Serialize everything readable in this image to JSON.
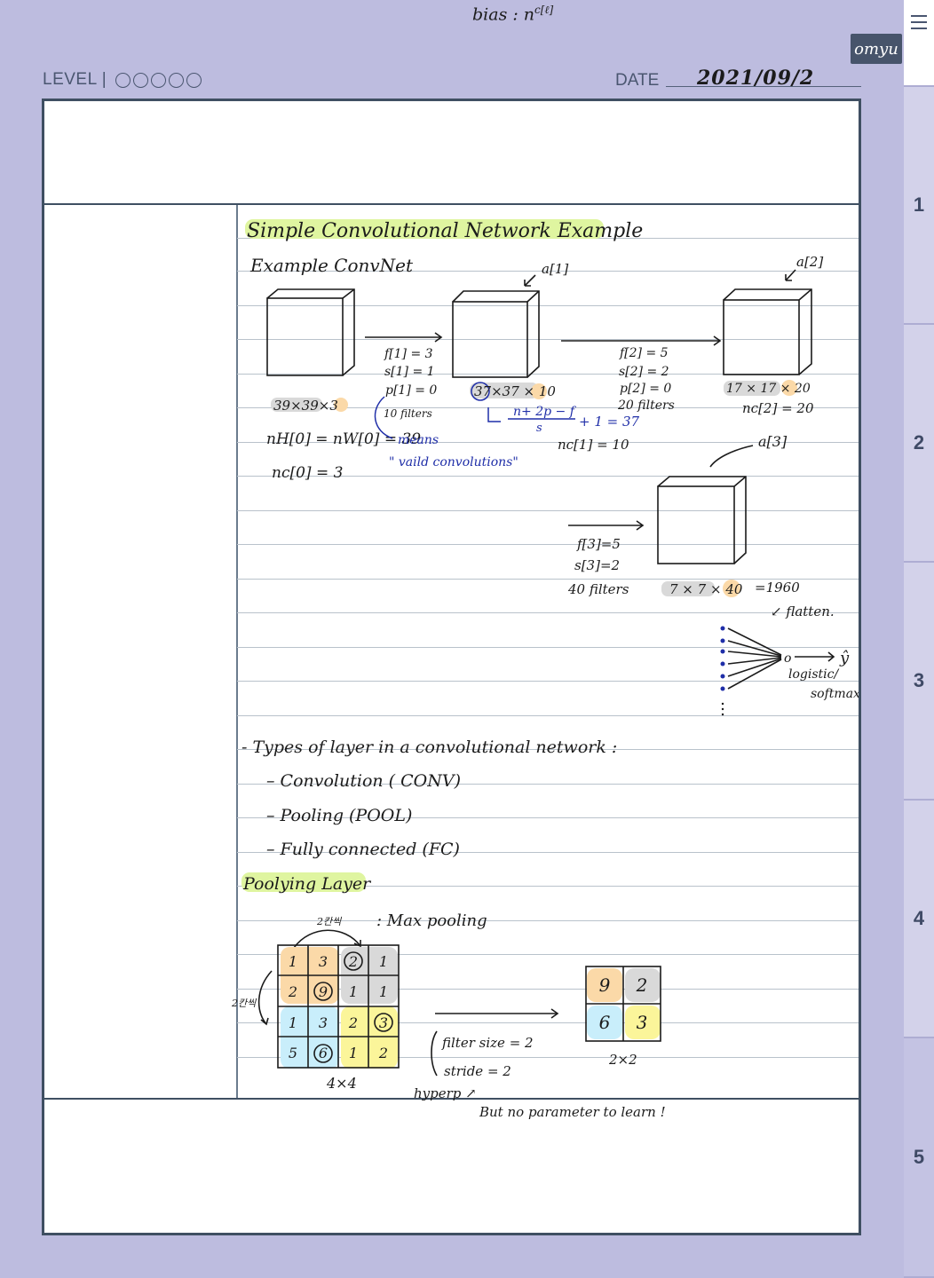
{
  "top": {
    "bias_note": "bias : n",
    "bias_sup": "c[ℓ]"
  },
  "header": {
    "level_label": "LEVEL |",
    "date_label": "DATE",
    "date_value": "2021/09/2"
  },
  "brand": {
    "name": "omyu"
  },
  "side_tabs": [
    "1",
    "2",
    "3",
    "4",
    "5"
  ],
  "colors": {
    "background": "#bdbcdf",
    "page_border": "#3f4f62",
    "highlight_green": "#dff5a0",
    "highlight_orange": "#fbd9a8",
    "highlight_gray": "#d9d9d9",
    "highlight_blue": "#c9eefb",
    "highlight_yellow": "#fbf59a",
    "ink_blue": "#1f2ea8"
  },
  "notes": {
    "title": "Simple Convolutional Network Example",
    "subtitle": "Example ConvNet",
    "a1": "a[1]",
    "a2": "a[2]",
    "a3": "a[3]",
    "layer0": {
      "dims_prefix": "39×39×",
      "dims_channels": "3",
      "nh_nw": "nH[0] = nW[0] = 39",
      "nc": "nc[0] = 3"
    },
    "conv1": {
      "f": "f[1] = 3",
      "s": "s[1] = 1",
      "p": "p[1] = 0",
      "filters": "10 filters",
      "means": "means",
      "valid": "\" vaild convolutions\""
    },
    "layer1": {
      "dims_circled": "37",
      "dims_rest": "×37 ×",
      "dims_channels": "10",
      "formula_top": "n+ 2p − f",
      "formula_bottom": "s",
      "formula_tail": "+ 1 = 37",
      "nc": "nc[1] = 10"
    },
    "conv2": {
      "f": "f[2] = 5",
      "s": "s[2] = 2",
      "p": "p[2] = 0",
      "filters": "20 filters"
    },
    "layer2": {
      "dims_prefix": "17 × 17 ×",
      "dims_channels": "20",
      "nc": "nc[2] = 20"
    },
    "conv3": {
      "f": "f[3]=5",
      "s": "s[3]=2",
      "filters": "40 filters"
    },
    "layer3": {
      "dims_prefix": "7 × 7 ×",
      "dims_channels": "40",
      "total": "=1960",
      "flatten": "↙ flatten."
    },
    "output": {
      "node": "o",
      "yhat": "ŷ",
      "activation_1": "logistic/",
      "activation_2": "softmax"
    },
    "types_heading": "- Types of layer in a convolutional network :",
    "types": [
      "– Convolution ( CONV)",
      "– Pooling  (POOL)",
      "– Fully connected  (FC)"
    ],
    "pooling_heading": "Poolying Layer",
    "pooling": {
      "step_right": "2칸씩",
      "step_down": "2칸씩",
      "method": ": Max pooling",
      "input_grid": [
        [
          "1",
          "3",
          "2",
          "1"
        ],
        [
          "2",
          "9",
          "1",
          "1"
        ],
        [
          "1",
          "3",
          "2",
          "3"
        ],
        [
          "5",
          "6",
          "1",
          "2"
        ]
      ],
      "input_label": "4×4",
      "output_grid": [
        [
          "9",
          "2"
        ],
        [
          "6",
          "3"
        ]
      ],
      "output_label": "2×2",
      "filter_size": "filter size = 2",
      "stride": "stride   =   2",
      "hyperp": "hyperp ↗",
      "note": "But no parameter to learn !"
    }
  }
}
